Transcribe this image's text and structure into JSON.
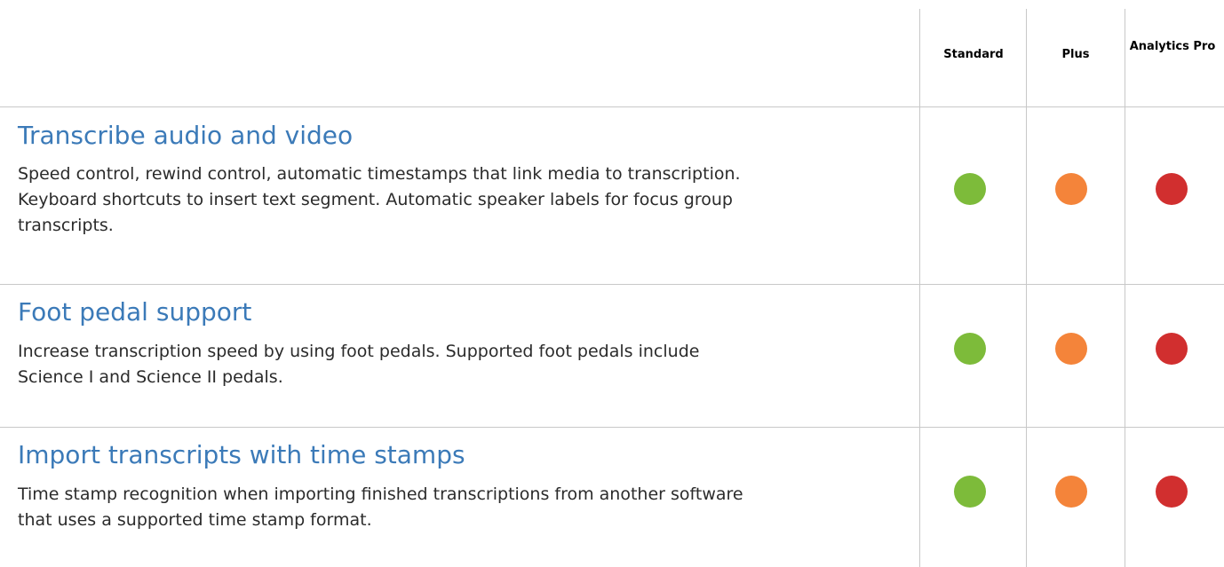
{
  "tiers": [
    "Standard",
    "Plus",
    "Analytics Pro"
  ],
  "colors": {
    "standard": "#7dbb3a",
    "plus": "#f4843a",
    "analytics_pro": "#d12f2f",
    "title": "#3b7ab8",
    "divider": "#c8c8c8"
  },
  "features": [
    {
      "title": "Transcribe audio and video",
      "description": "Speed control, rewind control, automatic timestamps that link media to transcription. Keyboard shortcuts to insert text segment. Automatic speaker labels for focus group transcripts.",
      "included": [
        true,
        true,
        true
      ]
    },
    {
      "title": "Foot pedal support",
      "description": "Increase transcription speed by using foot pedals. Supported foot pedals include Science I and Science II pedals.",
      "included": [
        true,
        true,
        true
      ]
    },
    {
      "title": "Import transcripts with time stamps",
      "description": "Time stamp recognition when importing finished transcriptions from another software that uses a supported time stamp format.",
      "included": [
        true,
        true,
        true
      ]
    }
  ]
}
